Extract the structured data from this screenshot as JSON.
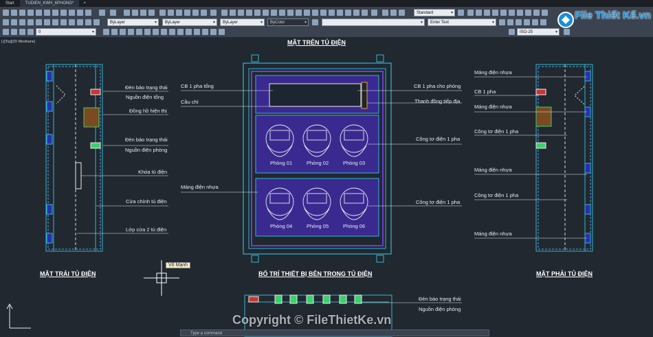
{
  "tabs": [
    {
      "label": "Start"
    },
    {
      "label": "TUDIEN_KWH_6PHONG*"
    },
    {
      "label": "+"
    }
  ],
  "toolbar": {
    "text_style": "Standard",
    "layer": "ByLayer",
    "linetype": "ByLayer",
    "lineweight": "ByLayer",
    "plot_style": "ByColor",
    "search_placeholder": "Enter Text",
    "dim_style": "ISO-25",
    "layer_number": "0"
  },
  "viewport": {
    "label": "[-][Top][2D Wireframe]"
  },
  "drawing": {
    "titles": {
      "top_view": "MẶT TRÊN TỦ ĐIỆN",
      "left_view": "MẶT TRÁI TỦ ĐIỆN",
      "inside_view": "BỐ TRÍ THIẾT BỊ BÊN TRONG TỦ ĐIỆN",
      "right_view": "MẶT PHẢI TỦ ĐIỆN"
    },
    "left_labels": [
      "Đèn báo trạng thái",
      "Nguồn điện tổng",
      "Đồng hồ hiện thị",
      "Đèn báo trạng thái",
      "Nguồn điện phòng",
      "Khóa tủ điện",
      "Cửa chính tủ điện",
      "Lớp cửa 2 tủ điện"
    ],
    "center_left_labels": [
      "CB 1 pha tổng",
      "Cầu chì",
      "Máng điện nhựa"
    ],
    "center_right_labels": [
      "CB 1 pha cho phòng",
      "Thanh đồng tiếp địa",
      "Công tơ điện 1 pha",
      "Công tơ điện 1 pha"
    ],
    "rooms": [
      "Phòng 01",
      "Phòng 02",
      "Phòng 03",
      "Phòng 04",
      "Phòng 05",
      "Phòng 06"
    ],
    "right_labels": [
      "Máng điện nhựa",
      "CB 1 pha",
      "Máng điện nhựa",
      "Công tơ điện 1 pha",
      "Máng điện nhựa",
      "Công tơ điện 1 pha",
      "Máng điện nhựa"
    ],
    "bottom_labels": [
      "Đèn báo trạng thái",
      "Nguồn điện phòng"
    ],
    "author_tag": "Võ Mạnh"
  },
  "command": {
    "placeholder": "Type a command"
  },
  "logo": {
    "text": "File Thiết Kế.vn"
  },
  "watermark": {
    "text": "Copyright © FileThietKe.vn"
  },
  "colors": {
    "background": "#212830",
    "cabinet": "#2fb8d4",
    "tray": "#6a3fd8",
    "meter": "#e8ecf0"
  }
}
